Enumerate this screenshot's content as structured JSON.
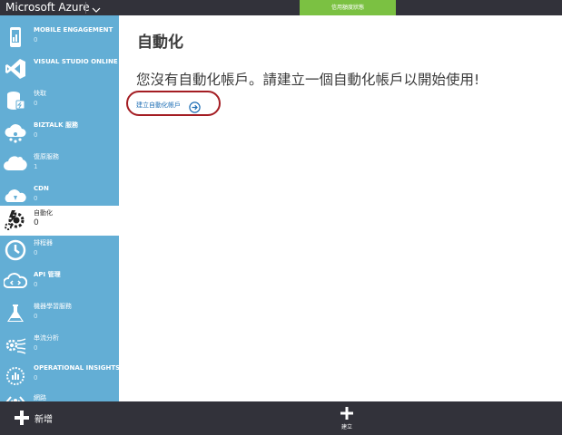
{
  "topbar": {
    "brand": "Microsoft Azure",
    "credit_status": "信用額度狀態"
  },
  "sidebar": {
    "items": [
      {
        "title": "MOBILE ENGAGEMENT",
        "count": "0",
        "icon": "mobile-engagement-icon"
      },
      {
        "title": "VISUAL STUDIO ONLINE",
        "count": "0",
        "icon": "visual-studio-icon"
      },
      {
        "title": "快取",
        "count": "0",
        "icon": "cache-icon"
      },
      {
        "title": "BIZTALK 服務",
        "count": "0",
        "icon": "biztalk-icon"
      },
      {
        "title": "復原服務",
        "count": "1",
        "icon": "recovery-services-icon"
      },
      {
        "title": "CDN",
        "count": "0",
        "icon": "cdn-icon"
      },
      {
        "title": "自動化",
        "count": "0",
        "icon": "automation-icon",
        "active": true
      },
      {
        "title": "排程器",
        "count": "0",
        "icon": "scheduler-icon"
      },
      {
        "title": "API 管理",
        "count": "0",
        "icon": "api-management-icon"
      },
      {
        "title": "機器學習服務",
        "count": "0",
        "icon": "machine-learning-icon"
      },
      {
        "title": "串流分析",
        "count": "0",
        "icon": "stream-analytics-icon"
      },
      {
        "title": "OPERATIONAL INSIGHTS",
        "count": "0",
        "icon": "operational-insights-icon"
      },
      {
        "title": "網路",
        "count": "",
        "icon": "networks-icon"
      }
    ]
  },
  "main": {
    "title": "自動化",
    "empty_message": "您沒有自動化帳戶。請建立一個自動化帳戶以開始使用!",
    "create_link": "建立自動化帳戶"
  },
  "bottombar": {
    "new_label": "新增",
    "create_label": "建立"
  },
  "colors": {
    "sidebar": "#63aed5",
    "topbar": "#32323a",
    "credit_badge": "#7bc142",
    "link": "#1f6fb5",
    "highlight": "#a41d23"
  }
}
